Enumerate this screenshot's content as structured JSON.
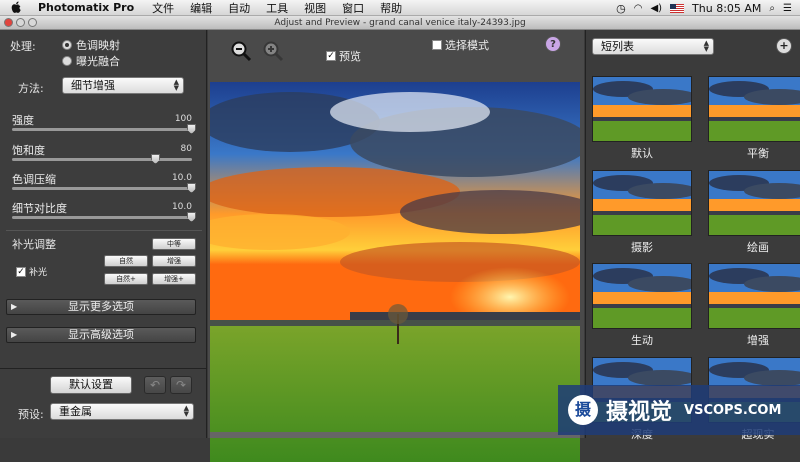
{
  "menubar": {
    "app_name": "Photomatix Pro",
    "items": [
      "文件",
      "编辑",
      "自动",
      "工具",
      "视图",
      "窗口",
      "帮助"
    ],
    "clock": "Thu 8:05 AM"
  },
  "window": {
    "title": "Adjust and Preview - grand canal venice italy-24393.jpg"
  },
  "left": {
    "process_label": "处理:",
    "process_options": [
      "色调映射",
      "曝光融合"
    ],
    "method_label": "方法:",
    "method_value": "细节增强",
    "sliders": [
      {
        "name": "强度",
        "value_text": "100",
        "fraction": 1.0
      },
      {
        "name": "饱和度",
        "value_text": "80",
        "fraction": 0.8
      },
      {
        "name": "色调压缩",
        "value_text": "10.0",
        "fraction": 1.0
      },
      {
        "name": "细节对比度",
        "value_text": "10.0",
        "fraction": 1.0
      }
    ],
    "fill_title": "补光调整",
    "fill_check_label": "补光",
    "fill_buttons": [
      "中等",
      "自然",
      "增强",
      "自然+",
      "增强+"
    ],
    "more_options": "显示更多选项",
    "advanced_options": "显示高级选项",
    "default_button": "默认设置",
    "preset_label": "预设:",
    "preset_value": "重金属"
  },
  "center": {
    "preview_label": "预览",
    "select_mode_label": "选择模式",
    "help": "?"
  },
  "right": {
    "view_select": "短列表",
    "add": "+",
    "thumbnails": [
      "默认",
      "平衡",
      "摄影",
      "绘画",
      "生动",
      "增强",
      "深度",
      "超现实"
    ]
  },
  "watermark": {
    "text": "摄视觉",
    "url": "VSCOPS.COM",
    "badge": "摄"
  },
  "colors": {
    "panel": "#3d3d3d",
    "accent_sky": "#3a78c8",
    "sunset": "#ff8a1a"
  }
}
